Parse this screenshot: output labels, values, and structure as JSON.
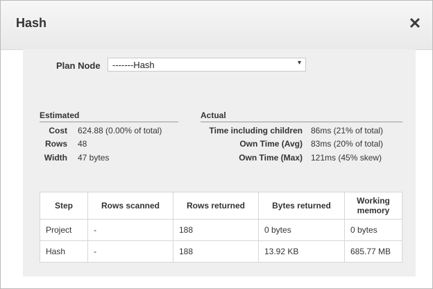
{
  "dialog": {
    "title": "Hash",
    "close_glyph": "✕"
  },
  "plan_node": {
    "label": "Plan Node",
    "selected": "-------Hash",
    "arrow": "▾"
  },
  "estimated": {
    "heading": "Estimated",
    "metrics": [
      {
        "label": "Cost",
        "value": "624.88 (0.00% of total)"
      },
      {
        "label": "Rows",
        "value": "48"
      },
      {
        "label": "Width",
        "value": "47 bytes"
      }
    ]
  },
  "actual": {
    "heading": "Actual",
    "metrics": [
      {
        "label": "Time including children",
        "value": "86ms (21% of total)"
      },
      {
        "label": "Own Time (Avg)",
        "value": "83ms (20% of total)"
      },
      {
        "label": "Own Time (Max)",
        "value": "121ms (45% skew)"
      }
    ]
  },
  "steps_table": {
    "headers": [
      "Step",
      "Rows scanned",
      "Rows returned",
      "Bytes returned",
      "Working memory"
    ],
    "rows": [
      [
        "Project",
        "-",
        "188",
        "0 bytes",
        "0 bytes"
      ],
      [
        "Hash",
        "-",
        "188",
        "13.92 KB",
        "685.77 MB"
      ]
    ]
  },
  "colors": {
    "panel_bg": "#efefef",
    "titlebar_bg": "#ececec"
  }
}
